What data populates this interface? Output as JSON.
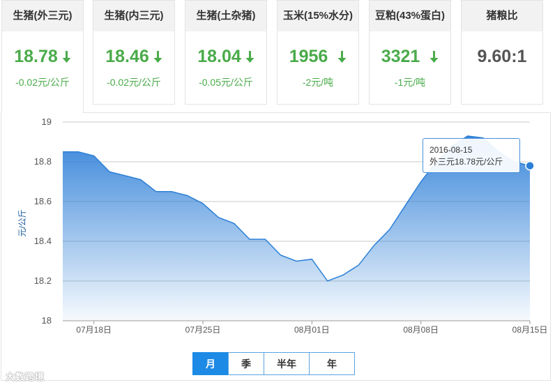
{
  "cards": [
    {
      "title": "生猪(外三元)",
      "value": "18.78",
      "change": "-0.02元/公斤",
      "trend": "down"
    },
    {
      "title": "生猪(内三元)",
      "value": "18.46",
      "change": "-0.02元/公斤",
      "trend": "down"
    },
    {
      "title": "生猪(土杂猪)",
      "value": "18.04",
      "change": "-0.05元/公斤",
      "trend": "down"
    },
    {
      "title": "玉米(15%水分)",
      "value": "1956",
      "change": "-2元/吨",
      "trend": "down"
    },
    {
      "title": "豆粕(43%蛋白)",
      "value": "3321",
      "change": "-1元/吨",
      "trend": "down"
    },
    {
      "title": "猪粮比",
      "value": "9.60:1",
      "change": "",
      "trend": "none"
    }
  ],
  "colors": {
    "down": "#4aab4a",
    "line": "#2c7fd6",
    "fill_top": "#2f80d8",
    "fill_bottom": "#ffffff"
  },
  "tooltip": {
    "date": "2016-08-15",
    "label": "外三元18.78元/公斤"
  },
  "range_buttons": [
    "月",
    "季",
    "半年",
    "年"
  ],
  "range_selected": "月",
  "watermark": "大数跨境",
  "chart_data": {
    "type": "area",
    "ylabel": "元/公斤",
    "ylim": [
      18,
      19
    ],
    "yticks": [
      18,
      18.2,
      18.4,
      18.6,
      18.8,
      19
    ],
    "xlim": [
      "2016-07-16",
      "2016-08-15"
    ],
    "xticks": [
      {
        "date": "2016-07-18",
        "label": "07月18日"
      },
      {
        "date": "2016-07-25",
        "label": "07月25日"
      },
      {
        "date": "2016-08-01",
        "label": "08月01日"
      },
      {
        "date": "2016-08-08",
        "label": "08月08日"
      },
      {
        "date": "2016-08-15",
        "label": "08月15日"
      }
    ],
    "grid": true,
    "series": [
      {
        "name": "外三元",
        "x": [
          "2016-07-16",
          "2016-07-17",
          "2016-07-18",
          "2016-07-19",
          "2016-07-20",
          "2016-07-21",
          "2016-07-22",
          "2016-07-23",
          "2016-07-24",
          "2016-07-25",
          "2016-07-26",
          "2016-07-27",
          "2016-07-28",
          "2016-07-29",
          "2016-07-30",
          "2016-07-31",
          "2016-08-01",
          "2016-08-02",
          "2016-08-03",
          "2016-08-04",
          "2016-08-05",
          "2016-08-06",
          "2016-08-07",
          "2016-08-08",
          "2016-08-09",
          "2016-08-10",
          "2016-08-11",
          "2016-08-12",
          "2016-08-13",
          "2016-08-14",
          "2016-08-15"
        ],
        "y": [
          18.85,
          18.85,
          18.83,
          18.75,
          18.73,
          18.71,
          18.65,
          18.65,
          18.63,
          18.59,
          18.52,
          18.49,
          18.41,
          18.41,
          18.33,
          18.3,
          18.31,
          18.2,
          18.23,
          18.28,
          18.38,
          18.46,
          18.58,
          18.7,
          18.8,
          18.88,
          18.93,
          18.92,
          18.85,
          18.8,
          18.78
        ]
      }
    ]
  }
}
